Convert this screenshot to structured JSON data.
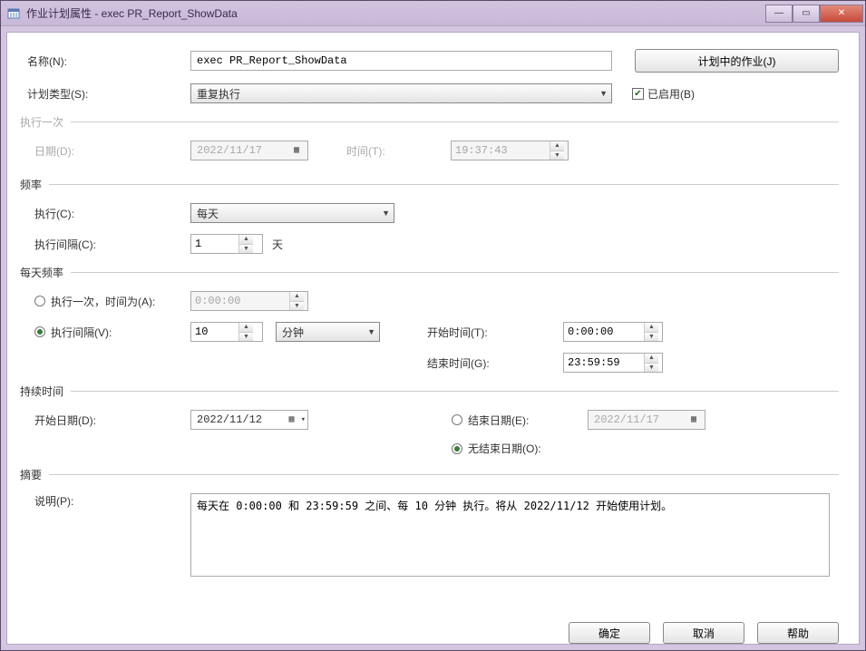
{
  "window": {
    "title": "作业计划属性 - exec PR_Report_ShowData"
  },
  "toprow": {
    "name_label": "名称(N):",
    "name_value": "exec PR_Report_ShowData",
    "jobs_button": "计划中的作业(J)"
  },
  "typerow": {
    "type_label": "计划类型(S):",
    "type_value": "重复执行",
    "enabled_label": "已启用(B)",
    "enabled_checked": true
  },
  "once": {
    "group": "执行一次",
    "date_label": "日期(D):",
    "date_value": "2022/11/17",
    "time_label": "时间(T):",
    "time_value": "19:37:43"
  },
  "freq": {
    "group": "频率",
    "exec_label": "执行(C):",
    "exec_value": "每天",
    "interval_label": "执行间隔(C):",
    "interval_value": "1",
    "interval_unit": "天"
  },
  "daily": {
    "group": "每天频率",
    "once_label": "执行一次，时间为(A):",
    "once_value": "0:00:00",
    "interval_label": "执行间隔(V):",
    "interval_value": "10",
    "interval_unit": "分钟",
    "start_label": "开始时间(T):",
    "start_value": "0:00:00",
    "end_label": "结束时间(G):",
    "end_value": "23:59:59",
    "selected": "interval"
  },
  "duration": {
    "group": "持续时间",
    "start_label": "开始日期(D):",
    "start_value": "2022/11/12",
    "end_label": "结束日期(E):",
    "end_value": "2022/11/17",
    "noend_label": "无结束日期(O):",
    "selected": "noend"
  },
  "summary": {
    "group": "摘要",
    "desc_label": "说明(P):",
    "desc_value": "每天在 0:00:00 和 23:59:59 之间、每 10 分钟 执行。将从 2022/11/12 开始使用计划。"
  },
  "buttons": {
    "ok": "确定",
    "cancel": "取消",
    "help": "帮助"
  }
}
